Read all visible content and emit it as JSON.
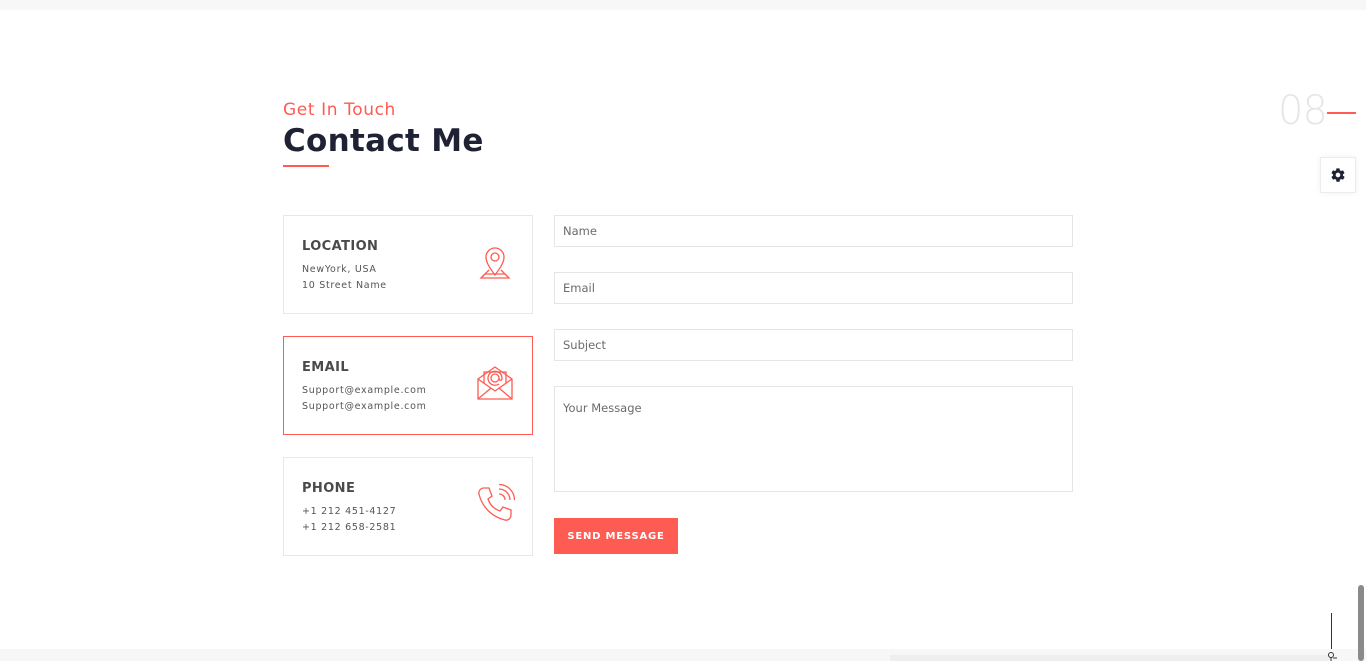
{
  "section": {
    "subtitle": "Get In Touch",
    "title": "Contact Me",
    "number": "08"
  },
  "cards": [
    {
      "heading": "LOCATION",
      "line1": "NewYork, USA",
      "line2": "10 Street Name",
      "icon": "map-pin-icon"
    },
    {
      "heading": "EMAIL",
      "line1": "Support@example.com",
      "line2": "Support@example.com",
      "icon": "envelope-icon"
    },
    {
      "heading": "PHONE",
      "line1": "+1 212 451-4127",
      "line2": "+1 212 658-2581",
      "icon": "phone-icon"
    }
  ],
  "form": {
    "name_placeholder": "Name",
    "email_placeholder": "Email",
    "subject_placeholder": "Subject",
    "message_placeholder": "Your Message",
    "submit_label": "SEND MESSAGE"
  },
  "colors": {
    "accent": "#fe5b52",
    "heading": "#1f2235",
    "border": "#e8e8e8"
  },
  "icons": {
    "settings": "gear-icon",
    "scroll": "scroll-indicator-icon"
  }
}
